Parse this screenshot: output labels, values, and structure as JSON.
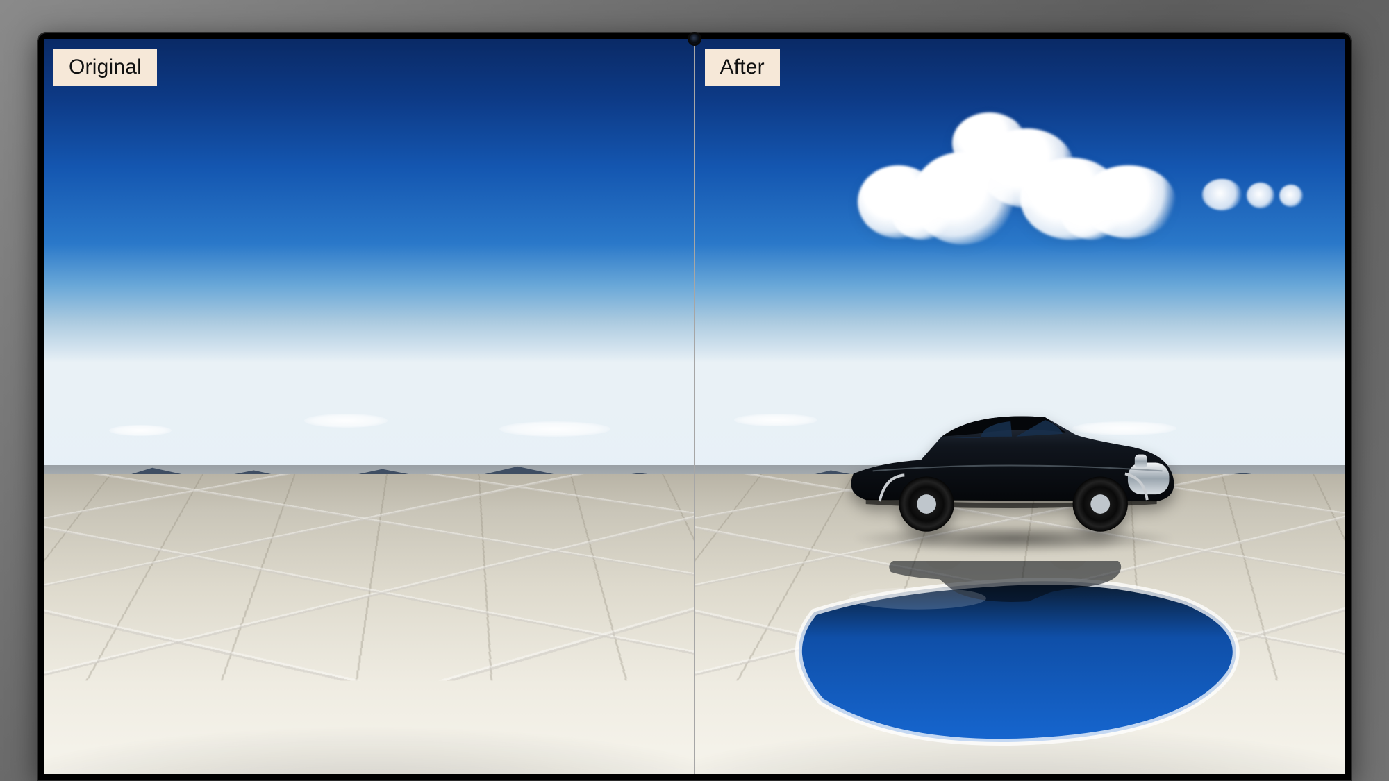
{
  "labels": {
    "original": "Original",
    "after": "After"
  },
  "scene": {
    "left_description": "desert salt flat under deep blue sky with distant mountains and sparse low clouds",
    "right_description": "same salt flat; added car-shaped cloud in sky, vintage black coupe on flat, reflective blue water pool in foreground"
  },
  "colors": {
    "sky_top": "#0a2a66",
    "sky_mid": "#2a78c9",
    "sky_horizon": "#e9f1f6",
    "salt": "#efece2",
    "label_bg": "#f6e8d8",
    "water": "#0f4fa8",
    "car_body": "#0a0d12"
  }
}
